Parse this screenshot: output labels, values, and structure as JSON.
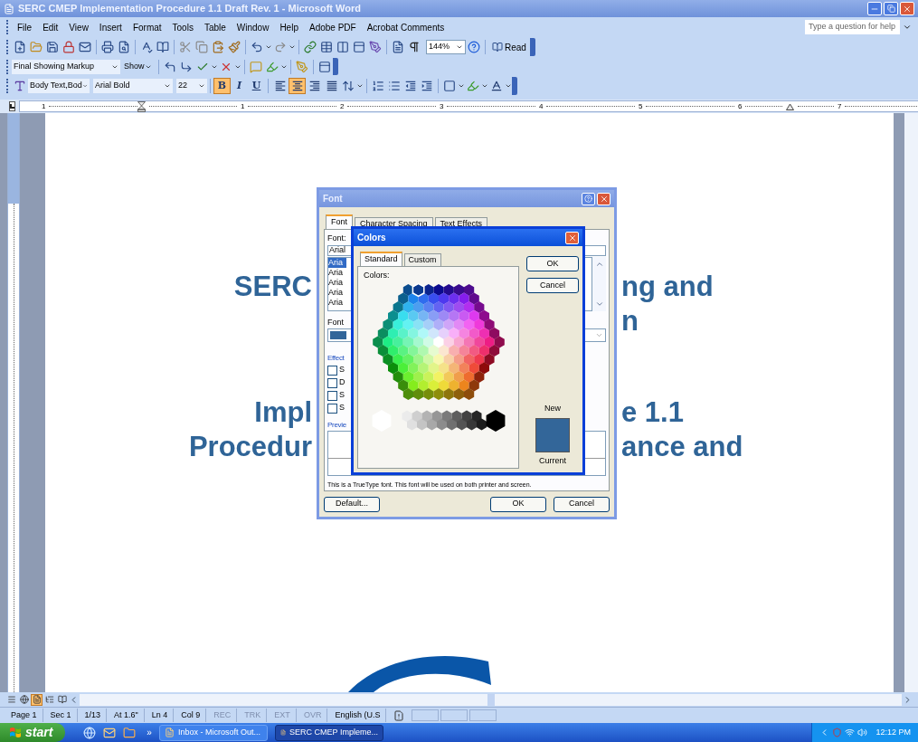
{
  "window": {
    "title": "SERC CMEP Implementation Procedure 1.1 Draft Rev. 1 - Microsoft Word"
  },
  "menu": [
    "File",
    "Edit",
    "View",
    "Insert",
    "Format",
    "Tools",
    "Table",
    "Window",
    "Help",
    "Adobe PDF",
    "Acrobat Comments"
  ],
  "help_box": {
    "placeholder": "Type a question for help"
  },
  "standard_toolbar": {
    "zoom": "144%",
    "read": "Read"
  },
  "reviewing_toolbar": {
    "display": "Final Showing Markup",
    "show": "Show"
  },
  "formatting_toolbar": {
    "style": "Body Text,Bod",
    "font": "Arial Bold",
    "size": "22",
    "text_buttons": [
      {
        "label": "B",
        "selected": true
      },
      {
        "label": "I",
        "selected": false
      },
      {
        "label": "U",
        "selected": false
      }
    ],
    "align_buttons": [
      {
        "kind": "left",
        "selected": false
      },
      {
        "kind": "center",
        "selected": true
      },
      {
        "kind": "right",
        "selected": false
      },
      {
        "kind": "justify",
        "selected": false
      }
    ]
  },
  "ruler": {
    "marks": [
      "1",
      "1",
      "2",
      "3",
      "4",
      "5",
      "6",
      "7"
    ]
  },
  "document": {
    "paragraphs": [
      {
        "lines": [
          {
            "left": "SERC",
            "right": "ng and"
          },
          {
            "right": "n"
          }
        ]
      },
      {
        "lines": [
          {
            "left": "Impl",
            "right": "e 1.1"
          },
          {
            "left": "Procedur",
            "right": "ance and"
          }
        ]
      }
    ]
  },
  "font_dialog": {
    "title": "Font",
    "tabs": [
      {
        "label": "Font",
        "selected": true
      },
      {
        "label": "Character Spacing",
        "selected": false
      },
      {
        "label": "Text Effects",
        "selected": false
      }
    ],
    "font_label": "Font:",
    "font_value": "Arial",
    "font_list": [
      {
        "label": "Aria",
        "selected": true
      },
      {
        "label": "Aria",
        "selected": false
      },
      {
        "label": "Aria",
        "selected": false
      },
      {
        "label": "Aria",
        "selected": false
      },
      {
        "label": "Aria",
        "selected": false
      }
    ],
    "color_label": "Font",
    "effects_label": "Effect",
    "effects": [
      {
        "label": "S",
        "checked": false
      },
      {
        "label": "D",
        "checked": false
      },
      {
        "label": "S",
        "checked": false
      },
      {
        "label": "S",
        "checked": false
      }
    ],
    "preview_label": "Previe",
    "note": "This is a TrueType font. This font will be used on both printer and screen.",
    "buttons": [
      "Default...",
      "OK",
      "Cancel"
    ]
  },
  "colors_dialog": {
    "title": "Colors",
    "tabs": [
      {
        "label": "Standard",
        "selected": true
      },
      {
        "label": "Custom",
        "selected": false
      }
    ],
    "colors_label": "Colors:",
    "buttons": [
      "OK",
      "Cancel"
    ],
    "new_label": "New",
    "current_label": "Current"
  },
  "view_buttons": [
    {
      "kind": "normal",
      "selected": false
    },
    {
      "kind": "web",
      "selected": false
    },
    {
      "kind": "print",
      "selected": true
    },
    {
      "kind": "outline",
      "selected": false
    },
    {
      "kind": "reading",
      "selected": false
    }
  ],
  "status_bar": {
    "fields": [
      {
        "text": "Page 1",
        "disabled": false
      },
      {
        "text": "Sec 1",
        "disabled": false
      },
      {
        "text": "1/13",
        "disabled": false
      },
      {
        "text": "At 1.6\"",
        "disabled": false
      },
      {
        "text": "Ln 4",
        "disabled": false
      },
      {
        "text": "Col 9",
        "disabled": false
      },
      {
        "text": "REC",
        "disabled": true
      },
      {
        "text": "TRK",
        "disabled": true
      },
      {
        "text": "EXT",
        "disabled": true
      },
      {
        "text": "OVR",
        "disabled": true
      },
      {
        "text": "English (U.S",
        "disabled": false
      }
    ]
  },
  "taskbar": {
    "start": "start",
    "overflow": "»",
    "tasks": [
      {
        "label": "Inbox - Microsoft Out...",
        "selected": false
      },
      {
        "label": "SERC CMEP Impleme...",
        "selected": true
      }
    ],
    "clock": "12:12 PM"
  }
}
